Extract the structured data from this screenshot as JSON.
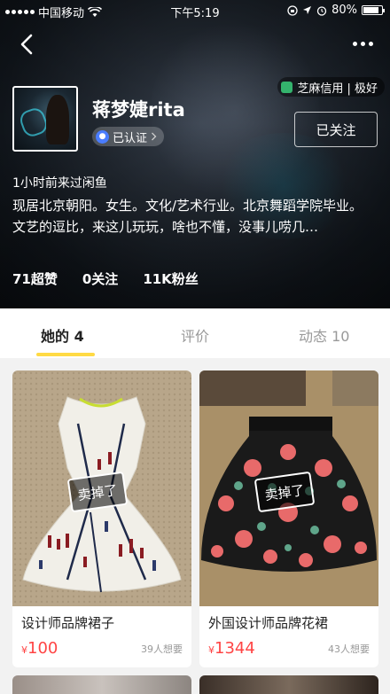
{
  "status_bar": {
    "carrier": "中国移动",
    "time": "下午5:19",
    "battery": "80%"
  },
  "profile": {
    "username": "蒋梦婕rita",
    "verified_label": "已认证",
    "credit_badge": "芝麻信用 | 极好",
    "follow_button": "已关注",
    "last_seen": "1小时前来过闲鱼",
    "bio": "现居北京朝阳。女生。文化/艺术行业。北京舞蹈学院毕业。文艺的逗比，来这儿玩玩，啥也不懂，没事儿唠几…",
    "stats": {
      "likes": "71超赞",
      "following": "0关注",
      "followers": "11K粉丝"
    }
  },
  "tabs": [
    {
      "label": "她的 4",
      "active": true
    },
    {
      "label": "评价",
      "active": false
    },
    {
      "label": "动态 10",
      "active": false
    }
  ],
  "products": [
    {
      "title": "设计师品牌裙子",
      "price_symbol": "¥",
      "price": "100",
      "wants": "39人想要",
      "status": "卖掉了"
    },
    {
      "title": "外国设计师品牌花裙",
      "price_symbol": "¥",
      "price": "1344",
      "wants": "43人想要",
      "status": "卖掉了"
    }
  ],
  "colors": {
    "accent_yellow": "#ffda44",
    "price_red": "#ff4444",
    "sesame_green": "#34b36d",
    "verified_blue": "#4a7dff"
  }
}
